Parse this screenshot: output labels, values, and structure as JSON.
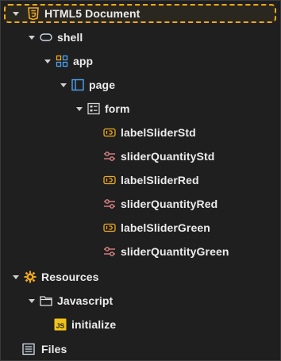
{
  "tree": {
    "root": {
      "label": "HTML5 Document",
      "icon": "html5-icon"
    },
    "shell": {
      "label": "shell",
      "icon": "shell-icon"
    },
    "app": {
      "label": "app",
      "icon": "app-icon"
    },
    "page": {
      "label": "page",
      "icon": "page-icon"
    },
    "form": {
      "label": "form",
      "icon": "form-icon"
    },
    "form_children": [
      {
        "label": "labelSliderStd",
        "icon": "label-icon"
      },
      {
        "label": "sliderQuantityStd",
        "icon": "slider-icon"
      },
      {
        "label": "labelSliderRed",
        "icon": "label-icon"
      },
      {
        "label": "sliderQuantityRed",
        "icon": "slider-icon"
      },
      {
        "label": "labelSliderGreen",
        "icon": "label-icon"
      },
      {
        "label": "sliderQuantityGreen",
        "icon": "slider-icon"
      }
    ],
    "resources": {
      "label": "Resources",
      "icon": "gear-icon"
    },
    "javascript": {
      "label": "Javascript",
      "icon": "folder-icon"
    },
    "initialize": {
      "label": "initialize",
      "icon": "js-file-icon"
    },
    "files": {
      "label": "Files",
      "icon": "files-list-icon"
    }
  },
  "colors": {
    "selection_border": "#f0a91d",
    "icon_accent": "#f0a91d",
    "icon_blue": "#4ea3f2",
    "icon_slider": "#e98a8a",
    "background": "#1f1f1f"
  }
}
